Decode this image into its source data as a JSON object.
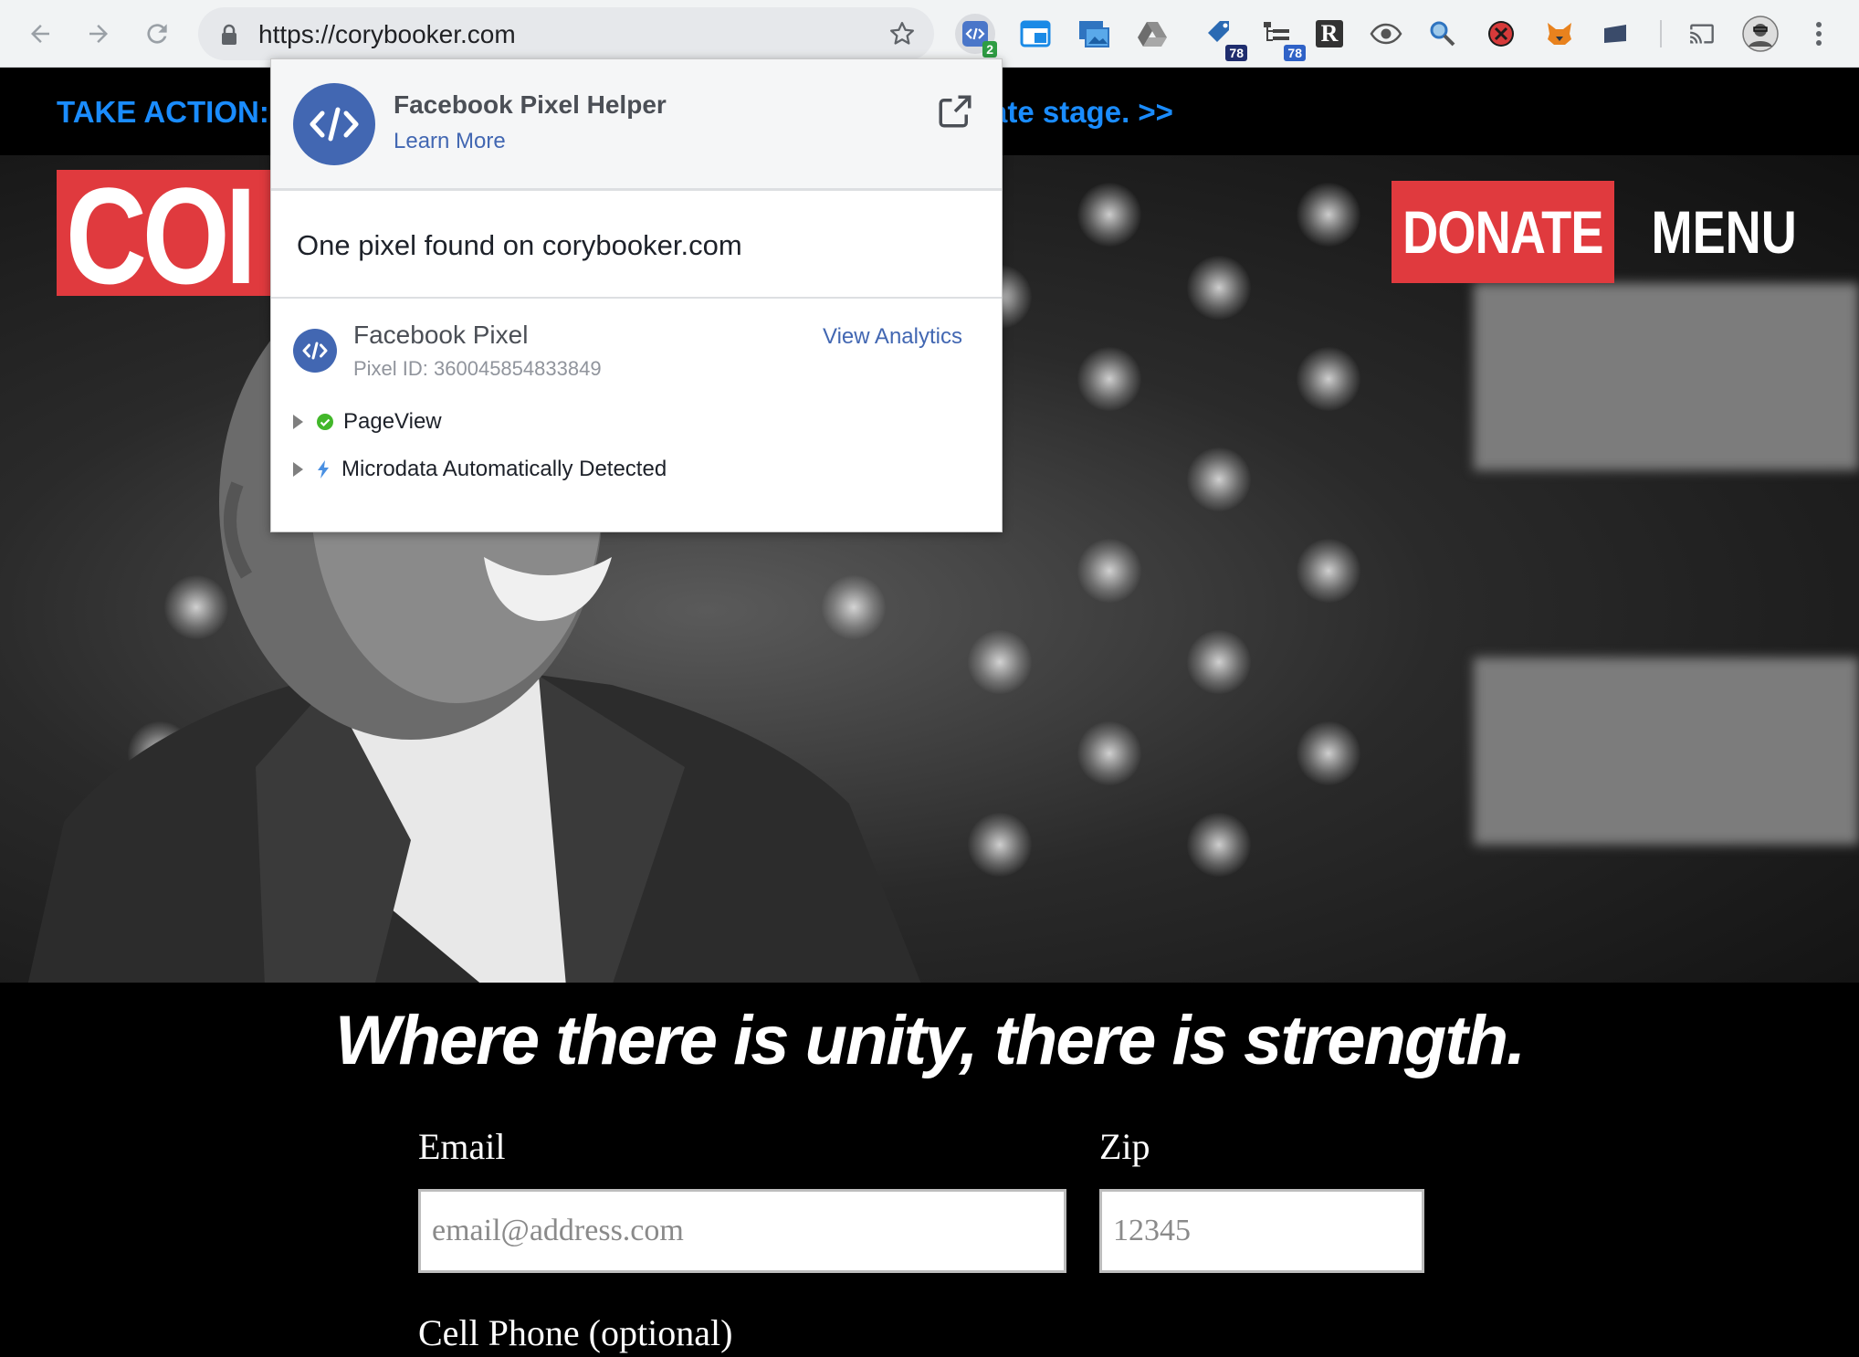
{
  "browser": {
    "url": "https://corybooker.com",
    "extensions": [
      {
        "name": "facebook-pixel-helper",
        "badge": "2"
      },
      {
        "name": "window-icon"
      },
      {
        "name": "screenshot-icon"
      },
      {
        "name": "drive-icon"
      },
      {
        "name": "tag-icon",
        "badge": "78"
      },
      {
        "name": "tree-icon",
        "badge": "78"
      },
      {
        "name": "r-icon",
        "label": "R"
      },
      {
        "name": "eye-icon"
      },
      {
        "name": "magnifier-icon"
      },
      {
        "name": "blocker-icon"
      },
      {
        "name": "fox-icon"
      },
      {
        "name": "card-icon"
      },
      {
        "name": "cast-icon"
      },
      {
        "name": "profile-icon"
      },
      {
        "name": "menu-dots-icon"
      }
    ]
  },
  "site": {
    "alert_left": "TAKE ACTION: C",
    "alert_right": "ate stage. >>",
    "logo_text": "COI",
    "donate_label": "DONATE",
    "menu_label": "MENU",
    "tagline": "Where there is unity, there is strength.",
    "form": {
      "email_label": "Email",
      "email_placeholder": "email@address.com",
      "zip_label": "Zip",
      "zip_placeholder": "12345",
      "phone_label": "Cell Phone (optional)"
    }
  },
  "popup": {
    "title": "Facebook Pixel Helper",
    "learn_more": "Learn More",
    "found_text": "One pixel found on corybooker.com",
    "pixel_name": "Facebook Pixel",
    "pixel_id": "Pixel ID: 360045854833849",
    "view_analytics": "View Analytics",
    "events": [
      "PageView",
      "Microdata Automatically Detected"
    ]
  },
  "colors": {
    "brand_red": "#e03a3e",
    "facebook_blue": "#4267b2",
    "alert_blue": "#1a8cff"
  }
}
